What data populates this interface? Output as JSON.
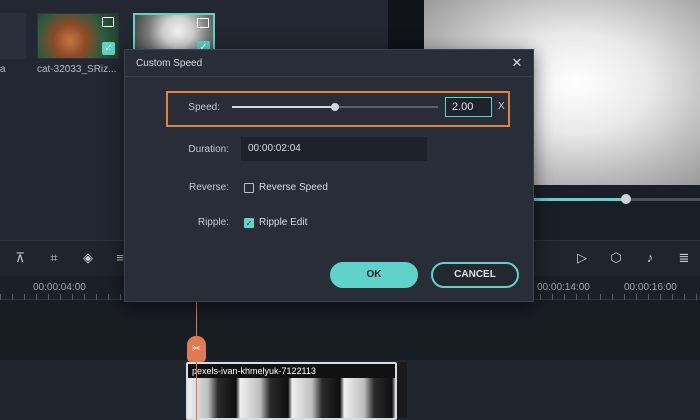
{
  "media": {
    "items": [
      {
        "label": "a"
      },
      {
        "label": "cat-32033_SRiz..."
      },
      {
        "label": ""
      }
    ]
  },
  "ruler": {
    "ticks": [
      "00:00:04:00",
      "00:00:14:00",
      "00:00:16:00"
    ]
  },
  "timeline": {
    "clip_label": "pexels-ivan-khmelyuk-7122113"
  },
  "dialog": {
    "title": "Custom Speed",
    "speed_label": "Speed:",
    "speed_value": "2.00",
    "speed_level": 0.5,
    "speed_unit": "X",
    "duration_label": "Duration:",
    "duration_value": "00:00:02:04",
    "reverse_label": "Reverse:",
    "reverse_checkbox_label": "Reverse Speed",
    "reverse_checked": false,
    "ripple_label": "Ripple:",
    "ripple_checkbox_label": "Ripple Edit",
    "ripple_checked": true,
    "ok_label": "OK",
    "cancel_label": "CANCEL"
  },
  "colors": {
    "accent": "#5fd3c9",
    "highlight": "#e3823a",
    "playhead": "#e07a52"
  },
  "icons": [
    "film-icon",
    "check-icon",
    "close-icon",
    "play-icon",
    "marker-icon",
    "mic-icon",
    "scissors-icon"
  ]
}
